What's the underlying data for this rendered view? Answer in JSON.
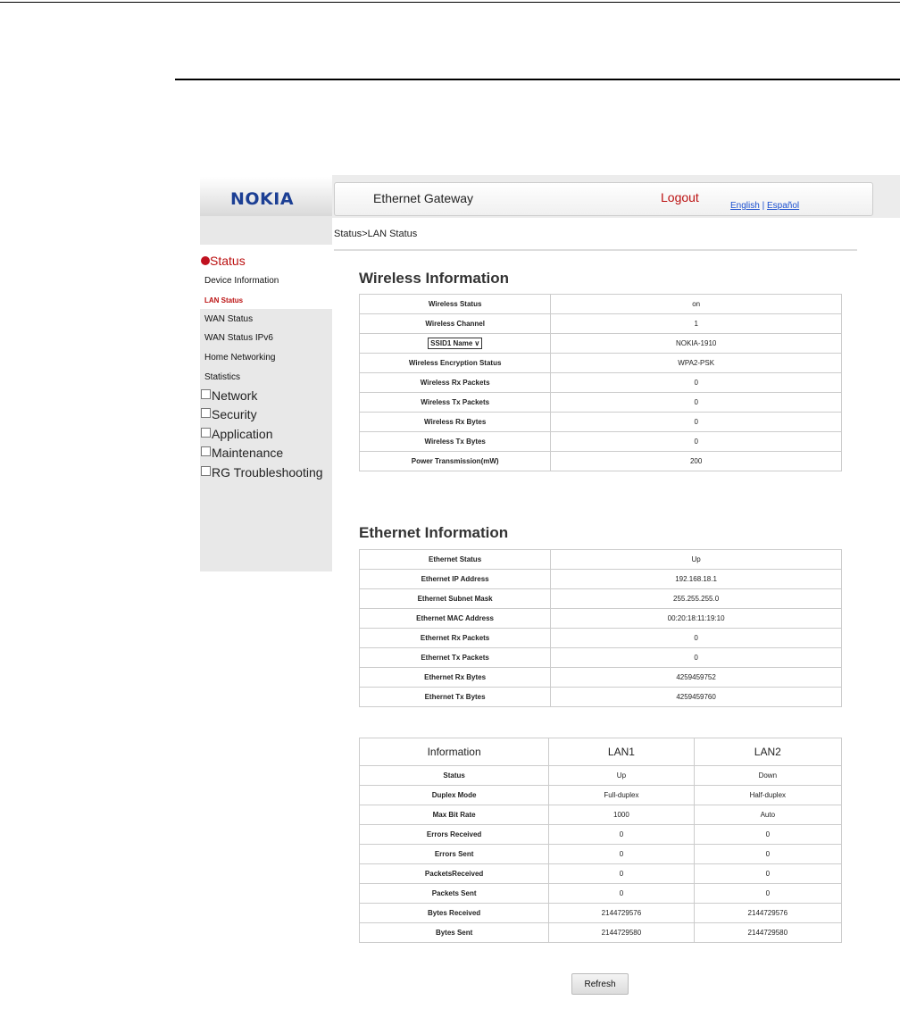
{
  "header": {
    "logo": "NOKIA",
    "title": "Ethernet Gateway",
    "logout": "Logout",
    "lang_en": "English",
    "lang_sep": "|",
    "lang_es": "Español"
  },
  "sidebar": {
    "status": "Status",
    "sub": [
      "Device Information",
      "LAN Status",
      "WAN Status",
      "WAN Status IPv6",
      "Home Networking",
      "Statistics"
    ],
    "groups": [
      "Network",
      "Security",
      "Application",
      "Maintenance",
      "RG Troubleshooting"
    ]
  },
  "breadcrumb": "Status>LAN Status",
  "wireless": {
    "title": "Wireless Information",
    "ssid_select": "SSID1 Name",
    "rows": [
      [
        "Wireless Status",
        "on"
      ],
      [
        "Wireless Channel",
        "1"
      ],
      [
        "SSID1 Name",
        "NOKIA-1910"
      ],
      [
        "Wireless Encryption Status",
        "WPA2-PSK"
      ],
      [
        "Wireless Rx Packets",
        "0"
      ],
      [
        "Wireless Tx Packets",
        "0"
      ],
      [
        "Wireless Rx Bytes",
        "0"
      ],
      [
        "Wireless Tx Bytes",
        "0"
      ],
      [
        "Power Transmission(mW)",
        "200"
      ]
    ]
  },
  "ethernet": {
    "title": "Ethernet Information",
    "rows": [
      [
        "Ethernet Status",
        "Up"
      ],
      [
        "Ethernet IP Address",
        "192.168.18.1"
      ],
      [
        "Ethernet Subnet Mask",
        "255.255.255.0"
      ],
      [
        "Ethernet MAC Address",
        "00:20:18:11:19:10"
      ],
      [
        "Ethernet Rx Packets",
        "0"
      ],
      [
        "Ethernet Tx Packets",
        "0"
      ],
      [
        "Ethernet Rx Bytes",
        "4259459752"
      ],
      [
        "Ethernet Tx Bytes",
        "4259459760"
      ]
    ]
  },
  "lan": {
    "headers": [
      "Information",
      "LAN1",
      "LAN2"
    ],
    "rows": [
      [
        "Status",
        "Up",
        "Down"
      ],
      [
        "Duplex Mode",
        "Full-duplex",
        "Half-duplex"
      ],
      [
        "Max Bit Rate",
        "1000",
        "Auto"
      ],
      [
        "Errors Received",
        "0",
        "0"
      ],
      [
        "Errors Sent",
        "0",
        "0"
      ],
      [
        "PacketsReceived",
        "0",
        "0"
      ],
      [
        "Packets Sent",
        "0",
        "0"
      ],
      [
        "Bytes Received",
        "2144729576",
        "2144729576"
      ],
      [
        "Bytes Sent",
        "2144729580",
        "2144729580"
      ]
    ]
  },
  "refresh_label": "Refresh"
}
